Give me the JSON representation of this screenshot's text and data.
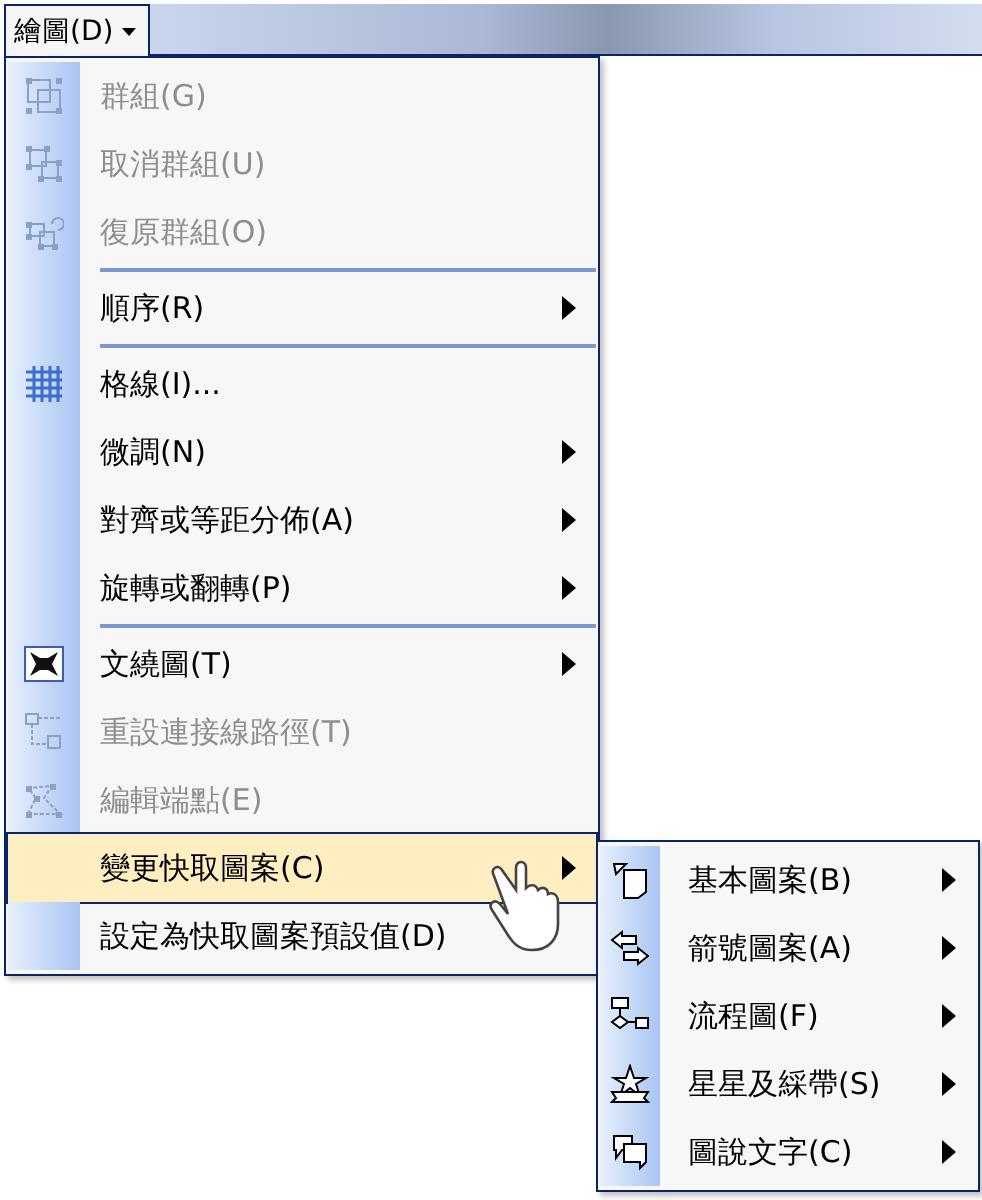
{
  "menu_button": {
    "label": "繪圖(D)",
    "open": true
  },
  "menu": {
    "items": [
      {
        "kind": "item",
        "label": "群組(G)",
        "disabled": true,
        "has_submenu": false,
        "selected": false
      },
      {
        "kind": "item",
        "label": "取消群組(U)",
        "disabled": true,
        "has_submenu": false,
        "selected": false
      },
      {
        "kind": "item",
        "label": "復原群組(O)",
        "disabled": true,
        "has_submenu": false,
        "selected": false
      },
      {
        "kind": "separator"
      },
      {
        "kind": "item",
        "label": "順序(R)",
        "disabled": false,
        "has_submenu": true,
        "selected": false
      },
      {
        "kind": "separator"
      },
      {
        "kind": "item",
        "label": "格線(I)...",
        "disabled": false,
        "has_submenu": false,
        "selected": false
      },
      {
        "kind": "item",
        "label": "微調(N)",
        "disabled": false,
        "has_submenu": true,
        "selected": false
      },
      {
        "kind": "item",
        "label": "對齊或等距分佈(A)",
        "disabled": false,
        "has_submenu": true,
        "selected": false
      },
      {
        "kind": "item",
        "label": "旋轉或翻轉(P)",
        "disabled": false,
        "has_submenu": true,
        "selected": false
      },
      {
        "kind": "separator"
      },
      {
        "kind": "item",
        "label": "文繞圖(T)",
        "disabled": false,
        "has_submenu": true,
        "selected": false
      },
      {
        "kind": "item",
        "label": "重設連接線路徑(T)",
        "disabled": true,
        "has_submenu": false,
        "selected": false
      },
      {
        "kind": "item",
        "label": "編輯端點(E)",
        "disabled": true,
        "has_submenu": false,
        "selected": false
      },
      {
        "kind": "item",
        "label": "變更快取圖案(C)",
        "disabled": false,
        "has_submenu": true,
        "selected": true
      },
      {
        "kind": "item",
        "label": "設定為快取圖案預設值(D)",
        "disabled": false,
        "has_submenu": false,
        "selected": false
      }
    ]
  },
  "submenu": {
    "items": [
      {
        "label": "基本圖案(B)",
        "selected": false
      },
      {
        "label": "箭號圖案(A)",
        "selected": false
      },
      {
        "label": "流程圖(F)",
        "selected": false
      },
      {
        "label": "星星及綵帶(S)",
        "selected": false
      },
      {
        "label": "圖說文字(C)",
        "selected": false
      }
    ]
  }
}
